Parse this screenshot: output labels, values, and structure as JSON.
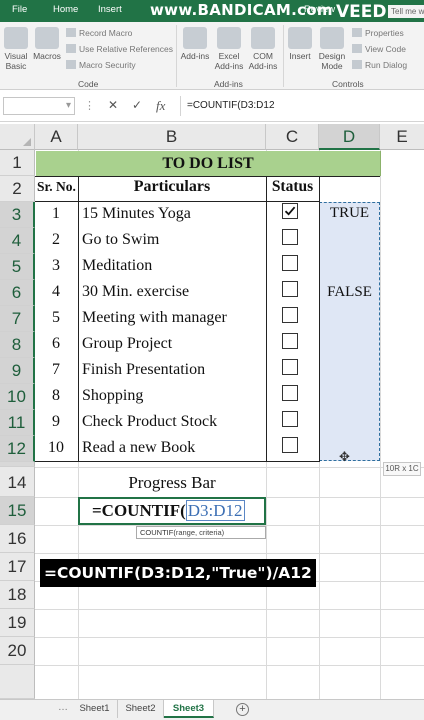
{
  "ribbon": {
    "tabs": [
      "File",
      "Home",
      "Insert",
      "Review"
    ],
    "watermark": "www.BANDICAM.com",
    "overlay_logo": "VEED",
    "tell_me": "Tell me what you want to do",
    "code_group": {
      "label": "Code",
      "visual_basic": "Visual Basic",
      "macros": "Macros",
      "record_macro": "Record Macro",
      "relative_refs": "Use Relative References",
      "macro_security": "Macro Security"
    },
    "addins_group": {
      "label": "Add-ins",
      "addins": "Add-ins",
      "excel_addins": "Excel Add-ins",
      "com_addins": "COM Add-ins"
    },
    "controls_group": {
      "label": "Controls",
      "insert": "Insert",
      "design_mode": "Design Mode",
      "properties": "Properties",
      "view_code": "View Code",
      "run_dialog": "Run Dialog"
    }
  },
  "formula_bar": {
    "name_box": "",
    "formula": "=COUNTIF(D3:D12"
  },
  "columns": [
    "A",
    "B",
    "C",
    "D",
    "E"
  ],
  "rows": [
    "1",
    "2",
    "3",
    "4",
    "5",
    "6",
    "7",
    "8",
    "9",
    "10",
    "11",
    "12",
    "14",
    "15",
    "16",
    "17",
    "18",
    "19",
    "20"
  ],
  "sheet": {
    "title": "TO DO LIST",
    "headers": {
      "sr_no": "Sr. No.",
      "particulars": "Particulars",
      "status": "Status"
    },
    "tasks": [
      {
        "no": "1",
        "name": "15 Minutes Yoga",
        "checked": true
      },
      {
        "no": "2",
        "name": "Go to Swim",
        "checked": false
      },
      {
        "no": "3",
        "name": "Meditation",
        "checked": false
      },
      {
        "no": "4",
        "name": "30 Min. exercise",
        "checked": false
      },
      {
        "no": "5",
        "name": "Meeting with manager",
        "checked": false
      },
      {
        "no": "6",
        "name": "Group Project",
        "checked": false
      },
      {
        "no": "7",
        "name": "Finish Presentation",
        "checked": false
      },
      {
        "no": "8",
        "name": "Shopping",
        "checked": false
      },
      {
        "no": "9",
        "name": "Check Product Stock",
        "checked": false
      },
      {
        "no": "10",
        "name": "Read a new Book",
        "checked": false
      }
    ],
    "d_true": "TRUE",
    "d_false": "FALSE",
    "selection_size": "10R x 1C",
    "progress_label": "Progress Bar",
    "cell_formula_prefix": "=COUNTIF(",
    "cell_formula_ref": "D3:D12",
    "tooltip_fn": "COUNTIF(",
    "tooltip_args": "range, criteria)",
    "caption": "=COUNTIF(D3:D12,\"True\")/A12"
  },
  "sheet_tabs": [
    "Sheet1",
    "Sheet2",
    "Sheet3"
  ],
  "active_sheet": "Sheet3",
  "colors": {
    "accent": "#217346",
    "title_fill": "#a9d18e",
    "selection": "#dfe7f5"
  }
}
